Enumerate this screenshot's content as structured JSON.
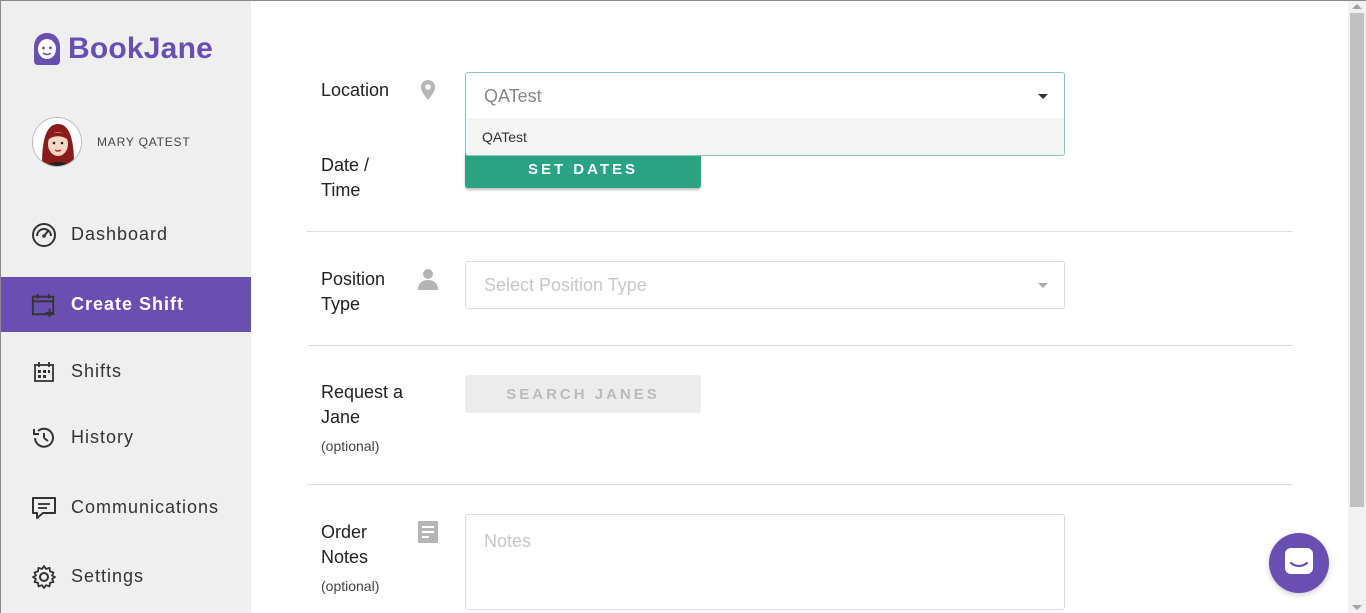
{
  "app": {
    "brand": "BookJane",
    "brand_color": "#6a4fb3",
    "accent_color": "#2aa383"
  },
  "profile": {
    "name": "MARY QATEST"
  },
  "sidebar": {
    "items": [
      {
        "label": "Dashboard",
        "icon": "dashboard-gauge-icon",
        "active": false
      },
      {
        "label": "Create Shift",
        "icon": "calendar-plus-icon",
        "active": true
      },
      {
        "label": "Shifts",
        "icon": "calendar-icon",
        "active": false
      },
      {
        "label": "History",
        "icon": "history-clock-icon",
        "active": false
      },
      {
        "label": "Communications",
        "icon": "chat-message-icon",
        "active": false
      },
      {
        "label": "Settings",
        "icon": "gear-icon",
        "active": false
      }
    ]
  },
  "form": {
    "location": {
      "label": "Location",
      "icon": "map-pin-icon",
      "value": "QATest",
      "options": [
        "QATest"
      ]
    },
    "date_time": {
      "label_line1": "Date /",
      "label_line2": "Time",
      "button": "SET DATES"
    },
    "position_type": {
      "label_line1": "Position",
      "label_line2": "Type",
      "icon": "person-icon",
      "placeholder": "Select Position Type"
    },
    "request_jane": {
      "label_line1": "Request a",
      "label_line2": "Jane",
      "optional": "(optional)",
      "button": "SEARCH JANES"
    },
    "order_notes": {
      "label_line1": "Order",
      "label_line2": "Notes",
      "optional": "(optional)",
      "icon": "note-icon",
      "placeholder": "Notes"
    }
  },
  "chat": {
    "icon": "chat-launcher-icon"
  }
}
